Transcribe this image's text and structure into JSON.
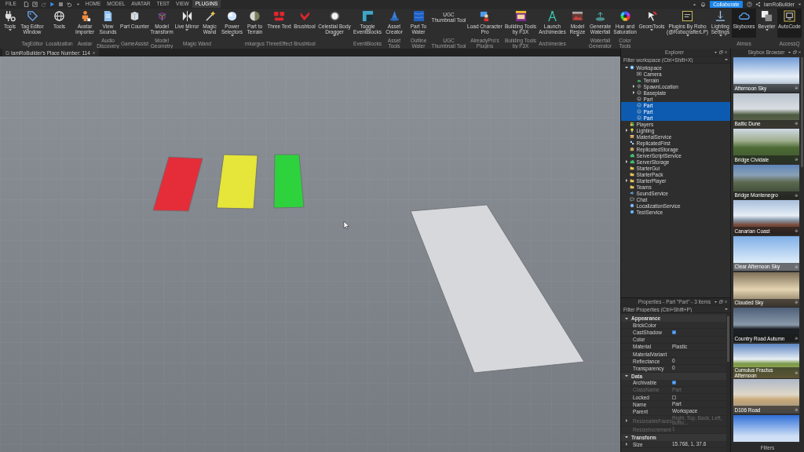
{
  "menu_bar": {
    "file": "FILE",
    "tabs": [
      {
        "label": "HOME",
        "selected": false
      },
      {
        "label": "MODEL",
        "selected": false
      },
      {
        "label": "AVATAR",
        "selected": false
      },
      {
        "label": "TEST",
        "selected": false
      },
      {
        "label": "VIEW",
        "selected": false
      },
      {
        "label": "PLUGINS",
        "selected": true
      }
    ],
    "collaborate": "Collaborate",
    "user": "IamRoBuilder"
  },
  "ribbon": {
    "groups": [
      {
        "buttons": [
          {
            "label": "Tools",
            "has_menu": true,
            "active": false
          }
        ]
      },
      {
        "label": "TagEditor",
        "buttons": [
          {
            "label": "Tag Editor Window",
            "has_menu": false,
            "active": false
          }
        ]
      },
      {
        "label": "Localization",
        "buttons": [
          {
            "label": "Tools",
            "has_menu": false,
            "active": false
          }
        ]
      },
      {
        "label": "Avatar",
        "buttons": [
          {
            "label": "Avatar Importer",
            "has_menu": false,
            "active": false
          }
        ]
      },
      {
        "label": "Audio Discovery",
        "buttons": [
          {
            "label": "View Sounds",
            "has_menu": false,
            "active": false
          }
        ]
      },
      {
        "label": "GameAssist",
        "buttons": [
          {
            "label": "Part Counter",
            "has_menu": false,
            "active": false
          }
        ]
      },
      {
        "label": "Model Geometry",
        "buttons": [
          {
            "label": "Model Transform",
            "has_menu": false,
            "active": false
          }
        ]
      },
      {
        "label": "Magic Wand",
        "buttons": [
          {
            "label": "Live Mirror",
            "has_menu": true,
            "active": false
          },
          {
            "label": "Magic Wand",
            "has_menu": false,
            "active": false
          }
        ]
      },
      {
        "buttons": [
          {
            "label": "Power Selectors",
            "has_menu": true,
            "active": false
          }
        ]
      },
      {
        "label": "mkargus",
        "buttons": [
          {
            "label": "Part to Terrain",
            "has_menu": false,
            "active": false
          }
        ]
      },
      {
        "label": "ThreeEffect",
        "buttons": [
          {
            "label": "Three Text",
            "has_menu": false,
            "active": false
          }
        ]
      },
      {
        "label": "Brushtool",
        "buttons": [
          {
            "label": "Brushtool",
            "has_menu": false,
            "active": false
          }
        ]
      },
      {
        "buttons": [
          {
            "label": "Celestial Body Dragger",
            "has_menu": true,
            "active": false
          }
        ]
      },
      {
        "label": "EventBlocks",
        "buttons": [
          {
            "label": "Toggle EventBlocks",
            "has_menu": false,
            "active": false
          }
        ]
      },
      {
        "label": "Asset Tools",
        "buttons": [
          {
            "label": "Asset Creator",
            "has_menu": false,
            "active": false
          }
        ]
      },
      {
        "label": "Outline Water",
        "buttons": [
          {
            "label": "Part To Water",
            "has_menu": false,
            "active": false
          }
        ]
      },
      {
        "label": "UGC Thumbnail Tool",
        "buttons": [
          {
            "label": "UGC Thumbnail Tool",
            "has_menu": false,
            "active": false
          }
        ]
      },
      {
        "label": "AlreadyPro's Plugins",
        "buttons": [
          {
            "label": "Load Character Pro",
            "has_menu": false,
            "active": false
          }
        ]
      },
      {
        "label": "Building Tools by F3X",
        "buttons": [
          {
            "label": "Building Tools by F3X",
            "has_menu": false,
            "active": false
          }
        ]
      },
      {
        "label": "Archimedes",
        "buttons": [
          {
            "label": "Launch Archimedes",
            "has_menu": false,
            "active": false
          }
        ]
      },
      {
        "buttons": [
          {
            "label": "Model Resize",
            "has_menu": true,
            "active": false
          }
        ]
      },
      {
        "label": "Waterfall Generator",
        "buttons": [
          {
            "label": "Generate Waterfall",
            "has_menu": false,
            "active": false
          }
        ]
      },
      {
        "label": "Color Tools",
        "buttons": [
          {
            "label": "Hue and Saturation",
            "has_menu": false,
            "active": false
          }
        ]
      },
      {
        "buttons": [
          {
            "label": "GeomTools",
            "has_menu": true,
            "active": false
          }
        ]
      },
      {
        "buttons": [
          {
            "label": "Plugins By Robo (@RobocrafterLP)",
            "has_menu": true,
            "active": false
          }
        ]
      },
      {
        "buttons": [
          {
            "label": "Lighting Settings",
            "has_menu": true,
            "active": false
          }
        ]
      },
      {
        "label": "Atmos",
        "buttons": [
          {
            "label": "Skyboxes",
            "has_menu": false,
            "active": true
          }
        ]
      },
      {
        "buttons": [
          {
            "label": "Beveler",
            "has_menu": true,
            "active": false
          }
        ]
      },
      {
        "label": "AccessQ",
        "buttons": [
          {
            "label": "AutoCode",
            "has_menu": false,
            "active": true
          }
        ]
      }
    ]
  },
  "document_tab": {
    "title": "IamRoBuilder's Place Number: 114"
  },
  "viewport": {
    "parts": [
      {
        "color": "#e52d3a"
      },
      {
        "color": "#e5e53a"
      },
      {
        "color": "#2ed23c"
      },
      {
        "color": "#d6d8dc"
      }
    ]
  },
  "explorer": {
    "title": "Explorer",
    "filter": {
      "placeholder": "Filter workspace (Ctrl+Shift+X)"
    },
    "tree": [
      {
        "label": "Workspace",
        "kind": "workspace",
        "selected": false,
        "expanded": true,
        "children": [
          {
            "label": "Camera",
            "kind": "camera",
            "selected": false
          },
          {
            "label": "Terrain",
            "kind": "terrain",
            "selected": false
          },
          {
            "label": "SpawnLocation",
            "kind": "spawn",
            "selected": false,
            "expanded": false
          },
          {
            "label": "Baseplate",
            "kind": "part",
            "selected": false,
            "expanded": false
          },
          {
            "label": "Part",
            "kind": "part",
            "selected": false
          },
          {
            "label": "Part",
            "kind": "part",
            "selected": true
          },
          {
            "label": "Part",
            "kind": "part",
            "selected": true
          },
          {
            "label": "Part",
            "kind": "part",
            "selected": true
          }
        ]
      },
      {
        "label": "Players",
        "kind": "players",
        "selected": false
      },
      {
        "label": "Lighting",
        "kind": "lighting",
        "selected": false,
        "expanded": false
      },
      {
        "label": "MaterialService",
        "kind": "material",
        "selected": false
      },
      {
        "label": "ReplicatedFirst",
        "kind": "replicated",
        "selected": false
      },
      {
        "label": "ReplicatedStorage",
        "kind": "storage",
        "selected": false
      },
      {
        "label": "ServerScriptService",
        "kind": "server",
        "selected": false
      },
      {
        "label": "ServerStorage",
        "kind": "server",
        "selected": false,
        "expanded": false
      },
      {
        "label": "StarterGui",
        "kind": "folder",
        "selected": false
      },
      {
        "label": "StarterPack",
        "kind": "folder",
        "selected": false
      },
      {
        "label": "StarterPlayer",
        "kind": "folder",
        "selected": false,
        "expanded": false
      },
      {
        "label": "Teams",
        "kind": "folder",
        "selected": false
      },
      {
        "label": "SoundService",
        "kind": "sound",
        "selected": false
      },
      {
        "label": "Chat",
        "kind": "chat",
        "selected": false
      },
      {
        "label": "LocalizationService",
        "kind": "localization",
        "selected": false
      },
      {
        "label": "TestService",
        "kind": "test",
        "selected": false
      }
    ]
  },
  "properties": {
    "title": "Properties - Part \"Part\" - 3 items",
    "filter": {
      "placeholder": "Filter Properties (Ctrl+Shift+P)"
    },
    "sections": [
      {
        "name": "Appearance",
        "expanded": true,
        "rows": [
          {
            "name": "BrickColor",
            "kind": "text",
            "disabled": false
          },
          {
            "name": "CastShadow",
            "kind": "checkbox",
            "checked": true,
            "disabled": false
          },
          {
            "name": "Color",
            "kind": "text",
            "disabled": false
          },
          {
            "name": "Material",
            "kind": "text",
            "value": "Plastic",
            "disabled": false
          },
          {
            "name": "MaterialVariant",
            "kind": "text",
            "disabled": false
          },
          {
            "name": "Reflectance",
            "kind": "text",
            "value": "0",
            "disabled": false
          },
          {
            "name": "Transparency",
            "kind": "text",
            "value": "0",
            "disabled": false
          }
        ]
      },
      {
        "name": "Data",
        "expanded": true,
        "rows": [
          {
            "name": "Archivable",
            "kind": "checkbox",
            "checked": true,
            "disabled": false
          },
          {
            "name": "ClassName",
            "kind": "text",
            "value": "Part",
            "disabled": true
          },
          {
            "name": "Locked",
            "kind": "checkbox",
            "checked": false,
            "disabled": false
          },
          {
            "name": "Name",
            "kind": "text",
            "value": "Part",
            "disabled": false
          },
          {
            "name": "Parent",
            "kind": "text",
            "value": "Workspace",
            "disabled": false
          },
          {
            "name": "ResizeableFaces",
            "kind": "text",
            "value": "Right, Top, Back, Left, Botto...",
            "disabled": true,
            "expanded": false
          },
          {
            "name": "ResizeIncrement",
            "kind": "text",
            "value": "1",
            "disabled": true
          }
        ]
      },
      {
        "name": "Transform",
        "expanded": true,
        "rows": [
          {
            "name": "Size",
            "kind": "text",
            "value": "15.768, 1, 37.6",
            "disabled": false,
            "expanded": false
          }
        ]
      }
    ]
  },
  "skybox_browser": {
    "title": "Skybox Browser",
    "skyboxes": [
      {
        "name": "Afternoon Sky"
      },
      {
        "name": "Baltic Dune"
      },
      {
        "name": "Bridge Cividale"
      },
      {
        "name": "Bridge Montenegro"
      },
      {
        "name": "Canarian Coast"
      },
      {
        "name": "Clear Afternoon Sky"
      },
      {
        "name": "Clouded Sky"
      },
      {
        "name": "Country Road Autumn"
      },
      {
        "name": "Cumulus Fractus Afternoon"
      },
      {
        "name": "D106 Road"
      }
    ],
    "partial_tile": true,
    "filters_button": "Filters"
  }
}
